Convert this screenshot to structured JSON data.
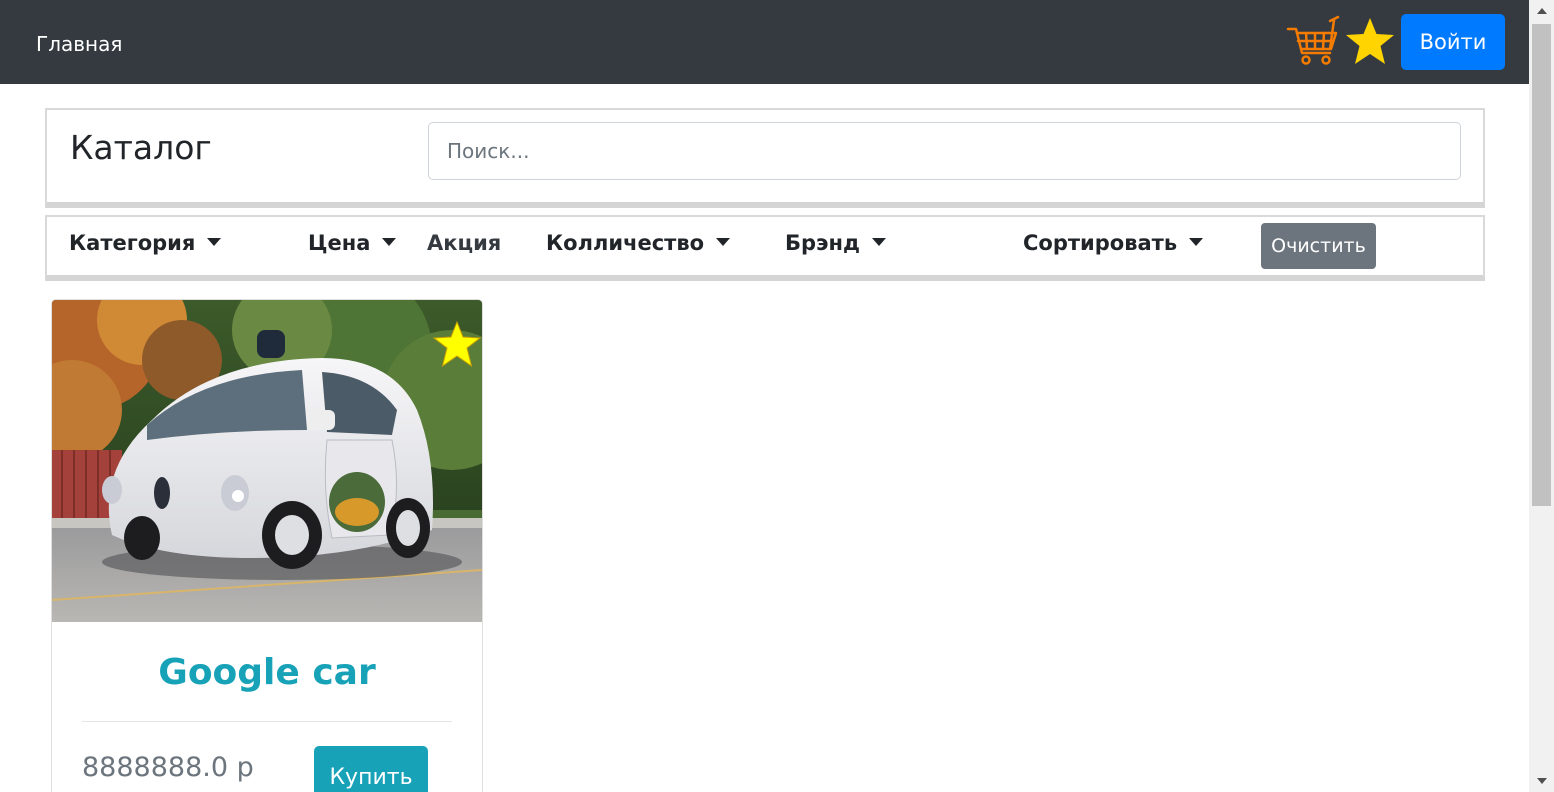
{
  "navbar": {
    "home_label": "Главная",
    "login_label": "Войти",
    "icons": {
      "cart": "cart-icon",
      "favorites": "star-icon"
    },
    "colors": {
      "background": "#343a40",
      "login": "#007bff",
      "cart": "#f57c00",
      "star": "#ffd400"
    }
  },
  "header": {
    "title": "Каталог",
    "search": {
      "placeholder": "Поиск...",
      "value": ""
    }
  },
  "filters": {
    "category": "Категория",
    "price": "Цена",
    "promo": "Акция",
    "quantity": "Колличество",
    "brand": "Брэнд",
    "sort": "Сортировать",
    "clear_label": "Очистить"
  },
  "products": [
    {
      "title": "Google car",
      "price": "8888888.0 р",
      "buy_label": "Купить",
      "favorite_icon": "star-icon"
    }
  ],
  "colors": {
    "accent": "#17a2b8",
    "secondary": "#6c757d"
  }
}
